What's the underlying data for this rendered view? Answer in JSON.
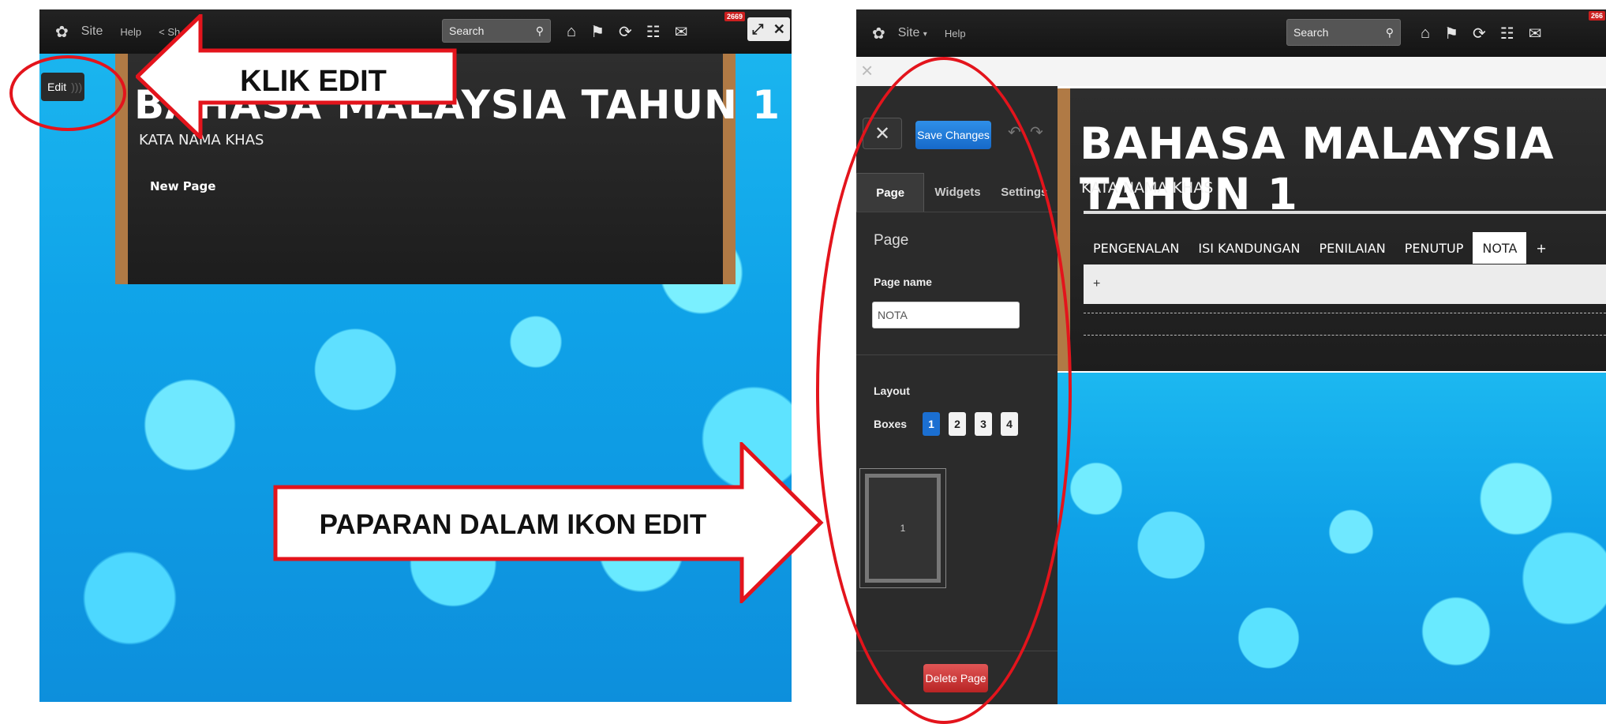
{
  "left": {
    "topbar": {
      "site": "Site",
      "help": "Help",
      "share": "Sh",
      "search_placeholder": "Search",
      "badge": "2669"
    },
    "edit_button": "Edit",
    "board_title": "BAHASA MALAYSIA TAHUN 1",
    "board_subtitle": "KATA NAMA KHAS",
    "new_page": "New Page",
    "callout_klik": "KLIK  EDIT",
    "callout_paparan": "PAPARAN DALAM IKON EDIT"
  },
  "right": {
    "topbar": {
      "site": "Site",
      "help": "Help",
      "search_placeholder": "Search",
      "badge": "266"
    },
    "close_x": "×",
    "save_changes": "Save Changes",
    "tabs": [
      "Page",
      "Widgets",
      "Settings"
    ],
    "section_page": "Page",
    "page_name_label": "Page name",
    "page_name_value": "NOTA",
    "layout_label": "Layout",
    "boxes_label": "Boxes",
    "boxes": [
      "1",
      "2",
      "3",
      "4"
    ],
    "layout_preview_number": "1",
    "delete_page": "Delete Page",
    "board_title": "BAHASA MALAYSIA TAHUN 1",
    "board_subtitle": "KATA NAMA KHAS",
    "menu": [
      "PENGENALAN",
      "ISI KANDUNGAN",
      "PENILAIAN",
      "PENUTUP",
      "NOTA",
      "+"
    ],
    "add_plus": "+"
  },
  "colors": {
    "annotation_red": "#e3141c",
    "save_blue": "#1669c9",
    "delete_red": "#b82424"
  }
}
